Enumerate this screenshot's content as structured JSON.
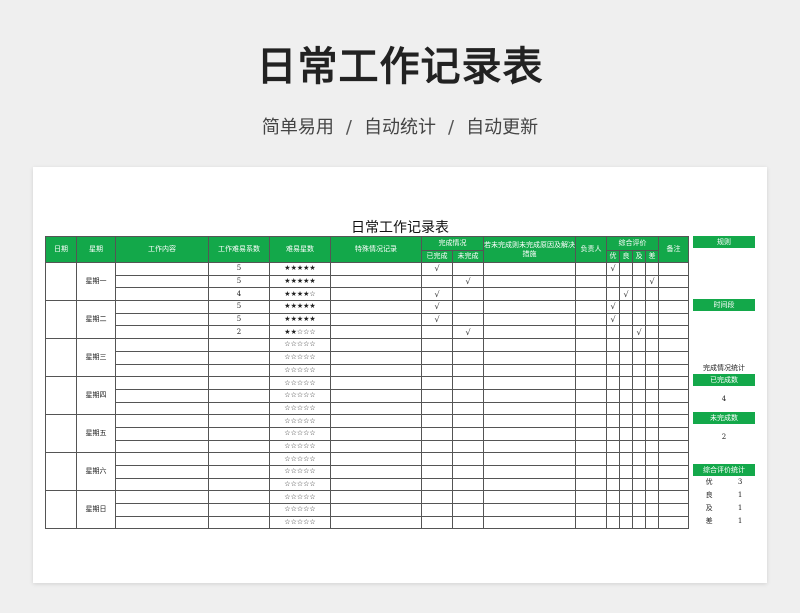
{
  "header": {
    "title": "日常工作记录表",
    "sub1": "简单易用",
    "sub2": "自动统计",
    "sub3": "自动更新",
    "sep": "/"
  },
  "sheet": {
    "title": "日常工作记录表"
  },
  "columns": {
    "date": "日期",
    "weekday": "星期",
    "content": "工作内容",
    "coef": "工作难易系数",
    "stars": "难易星数",
    "special": "特殊情况记录",
    "status": "完成情况",
    "done": "已完成",
    "undone": "未完成",
    "reason": "若未完成则未完成原因及解决措施",
    "owner": "负责人",
    "rating": "综合评价",
    "r1": "优",
    "r2": "良",
    "r3": "及",
    "r4": "差",
    "note": "备注"
  },
  "rows": [
    {
      "weekday": "星期一",
      "coef": "5",
      "stars": "★★★★★",
      "done": "√",
      "undone": "",
      "r1": "√",
      "r2": "",
      "r3": "",
      "r4": ""
    },
    {
      "weekday": "",
      "coef": "5",
      "stars": "★★★★★",
      "done": "",
      "undone": "√",
      "r1": "",
      "r2": "",
      "r3": "",
      "r4": "√"
    },
    {
      "weekday": "",
      "coef": "4",
      "stars": "★★★★☆",
      "done": "√",
      "undone": "",
      "r1": "",
      "r2": "√",
      "r3": "",
      "r4": ""
    },
    {
      "weekday": "星期二",
      "coef": "5",
      "stars": "★★★★★",
      "done": "√",
      "undone": "",
      "r1": "√",
      "r2": "",
      "r3": "",
      "r4": ""
    },
    {
      "weekday": "",
      "coef": "5",
      "stars": "★★★★★",
      "done": "√",
      "undone": "",
      "r1": "√",
      "r2": "",
      "r3": "",
      "r4": ""
    },
    {
      "weekday": "",
      "coef": "2",
      "stars": "★★☆☆☆",
      "done": "",
      "undone": "√",
      "r1": "",
      "r2": "",
      "r3": "√",
      "r4": ""
    },
    {
      "weekday": "星期三",
      "coef": "",
      "stars": "☆☆☆☆☆",
      "done": "",
      "undone": "",
      "r1": "",
      "r2": "",
      "r3": "",
      "r4": ""
    },
    {
      "weekday": "",
      "coef": "",
      "stars": "☆☆☆☆☆",
      "done": "",
      "undone": "",
      "r1": "",
      "r2": "",
      "r3": "",
      "r4": ""
    },
    {
      "weekday": "",
      "coef": "",
      "stars": "☆☆☆☆☆",
      "done": "",
      "undone": "",
      "r1": "",
      "r2": "",
      "r3": "",
      "r4": ""
    },
    {
      "weekday": "星期四",
      "coef": "",
      "stars": "☆☆☆☆☆",
      "done": "",
      "undone": "",
      "r1": "",
      "r2": "",
      "r3": "",
      "r4": ""
    },
    {
      "weekday": "",
      "coef": "",
      "stars": "☆☆☆☆☆",
      "done": "",
      "undone": "",
      "r1": "",
      "r2": "",
      "r3": "",
      "r4": ""
    },
    {
      "weekday": "",
      "coef": "",
      "stars": "☆☆☆☆☆",
      "done": "",
      "undone": "",
      "r1": "",
      "r2": "",
      "r3": "",
      "r4": ""
    },
    {
      "weekday": "星期五",
      "coef": "",
      "stars": "☆☆☆☆☆",
      "done": "",
      "undone": "",
      "r1": "",
      "r2": "",
      "r3": "",
      "r4": ""
    },
    {
      "weekday": "",
      "coef": "",
      "stars": "☆☆☆☆☆",
      "done": "",
      "undone": "",
      "r1": "",
      "r2": "",
      "r3": "",
      "r4": ""
    },
    {
      "weekday": "",
      "coef": "",
      "stars": "☆☆☆☆☆",
      "done": "",
      "undone": "",
      "r1": "",
      "r2": "",
      "r3": "",
      "r4": ""
    },
    {
      "weekday": "星期六",
      "coef": "",
      "stars": "☆☆☆☆☆",
      "done": "",
      "undone": "",
      "r1": "",
      "r2": "",
      "r3": "",
      "r4": ""
    },
    {
      "weekday": "",
      "coef": "",
      "stars": "☆☆☆☆☆",
      "done": "",
      "undone": "",
      "r1": "",
      "r2": "",
      "r3": "",
      "r4": ""
    },
    {
      "weekday": "",
      "coef": "",
      "stars": "☆☆☆☆☆",
      "done": "",
      "undone": "",
      "r1": "",
      "r2": "",
      "r3": "",
      "r4": ""
    },
    {
      "weekday": "星期日",
      "coef": "",
      "stars": "☆☆☆☆☆",
      "done": "",
      "undone": "",
      "r1": "",
      "r2": "",
      "r3": "",
      "r4": ""
    },
    {
      "weekday": "",
      "coef": "",
      "stars": "☆☆☆☆☆",
      "done": "",
      "undone": "",
      "r1": "",
      "r2": "",
      "r3": "",
      "r4": ""
    },
    {
      "weekday": "",
      "coef": "",
      "stars": "☆☆☆☆☆",
      "done": "",
      "undone": "",
      "r1": "",
      "r2": "",
      "r3": "",
      "r4": ""
    }
  ],
  "side": {
    "rules": "规则",
    "period": "时间段",
    "stats_title": "完成情况统计",
    "done_label": "已完成数",
    "done_value": "4",
    "undone_label": "未完成数",
    "undone_value": "2",
    "rating_title": "综合评价统计",
    "ratings": [
      {
        "k": "优",
        "v": "3"
      },
      {
        "k": "良",
        "v": "1"
      },
      {
        "k": "及",
        "v": "1"
      },
      {
        "k": "差",
        "v": "1"
      }
    ]
  },
  "colors": {
    "accent": "#13a84a"
  }
}
